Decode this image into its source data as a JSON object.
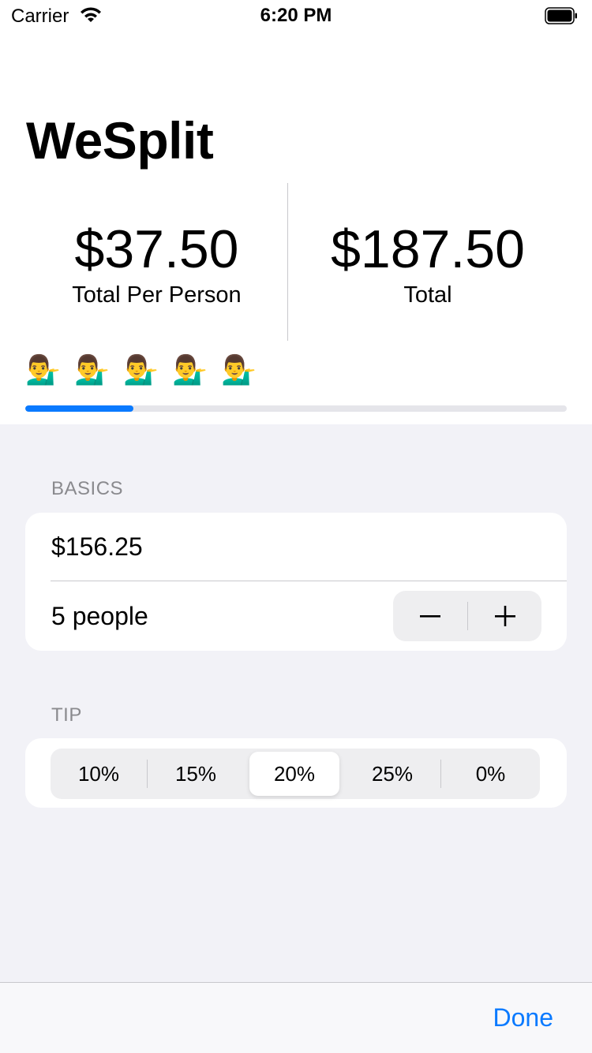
{
  "status_bar": {
    "carrier": "Carrier",
    "time": "6:20 PM"
  },
  "app": {
    "title": "WeSplit"
  },
  "totals": {
    "per_person_amount": "$37.50",
    "per_person_label": "Total Per Person",
    "total_amount": "$187.50",
    "total_label": "Total"
  },
  "people": {
    "count": 5,
    "emoji": "💁‍♂️",
    "progress_fraction": 0.2
  },
  "basics": {
    "header": "BASICS",
    "amount_value": "$156.25",
    "people_value": "5 people",
    "stepper_minus": "−",
    "stepper_plus": "+"
  },
  "tip": {
    "header": "TIP",
    "options": [
      "10%",
      "15%",
      "20%",
      "25%",
      "0%"
    ],
    "selected": "20%"
  },
  "toolbar": {
    "done_label": "Done"
  },
  "colors": {
    "accent": "#0a7aff",
    "background": "#f2f2f7",
    "secondary_text": "#8a8a8e"
  }
}
